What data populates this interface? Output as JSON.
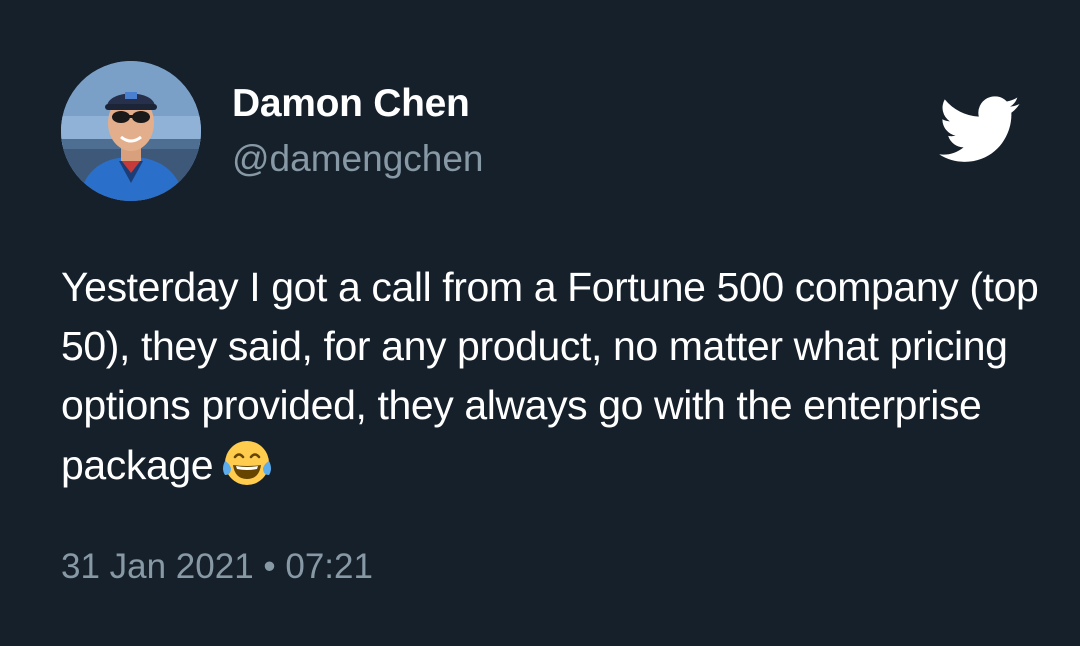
{
  "author": {
    "display_name": "Damon Chen",
    "handle": "@damengchen"
  },
  "tweet": {
    "text": "Yesterday I got a call from a Fortune 500 company (top 50), they said, for any product, no matter what pricing options provided, they always go with the enterprise package",
    "emoji": "face-with-tears-of-joy",
    "timestamp": "31 Jan 2021 • 07:21"
  },
  "icons": {
    "brand": "twitter-bird-icon"
  },
  "colors": {
    "background": "#15202b",
    "primary_text": "#ffffff",
    "secondary_text": "#8899a6"
  }
}
